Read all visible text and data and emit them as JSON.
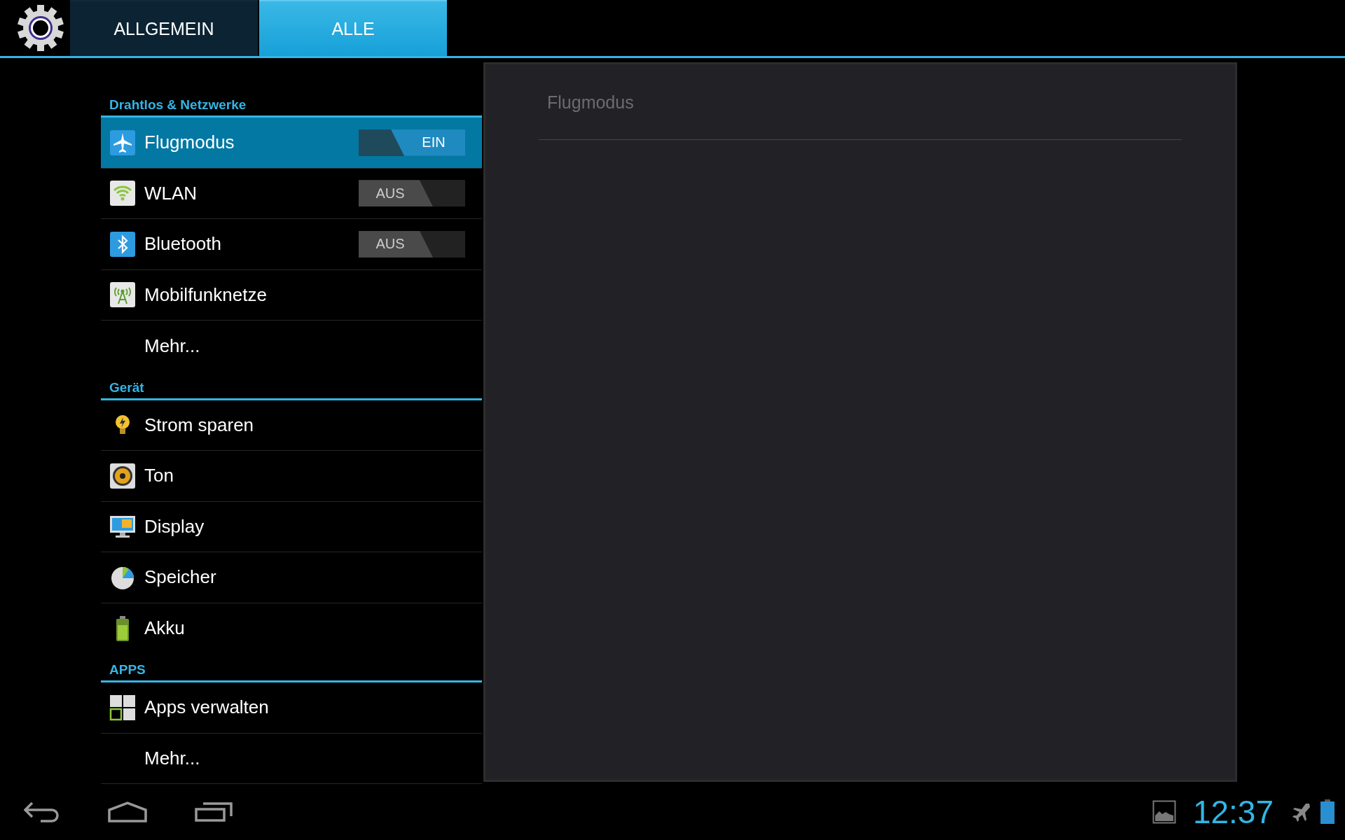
{
  "tabs": [
    {
      "label": "ALLGEMEIN",
      "selected": false
    },
    {
      "label": "ALLE",
      "selected": true
    }
  ],
  "sections": [
    {
      "title": "Drahtlos & Netzwerke",
      "items": [
        {
          "label": "Flugmodus",
          "selected": true,
          "switch": {
            "on": true,
            "label": "EIN"
          }
        },
        {
          "label": "WLAN",
          "selected": false,
          "switch": {
            "on": false,
            "label": "AUS"
          }
        },
        {
          "label": "Bluetooth",
          "selected": false,
          "switch": {
            "on": false,
            "label": "AUS"
          }
        },
        {
          "label": "Mobilfunknetze",
          "selected": false
        },
        {
          "label": "Mehr...",
          "selected": false
        }
      ]
    },
    {
      "title": "Gerät",
      "items": [
        {
          "label": "Strom sparen",
          "selected": false
        },
        {
          "label": "Ton",
          "selected": false
        },
        {
          "label": "Display",
          "selected": false
        },
        {
          "label": "Speicher",
          "selected": false
        },
        {
          "label": "Akku",
          "selected": false
        }
      ]
    },
    {
      "title": "APPS",
      "items": [
        {
          "label": "Apps verwalten",
          "selected": false
        },
        {
          "label": "Mehr...",
          "selected": false
        }
      ]
    }
  ],
  "detail": {
    "title": "Flugmodus"
  },
  "status_bar": {
    "time": "12:37"
  }
}
